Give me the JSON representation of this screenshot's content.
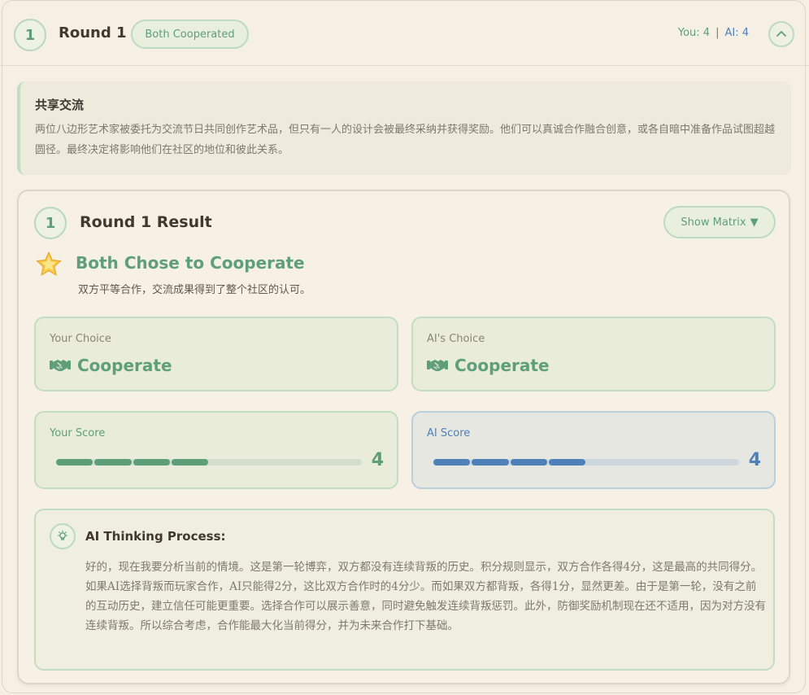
{
  "header": {
    "round_number": "1",
    "round_label": "Round 1",
    "status": "Both Cooperated",
    "you_label": "You:",
    "you_score": "4",
    "separator": "|",
    "ai_label": "AI:",
    "ai_score": "4",
    "collapse_icon": "chevron-up-icon"
  },
  "scenario": {
    "title": "共享交流",
    "description": "两位八边形艺术家被委托为交流节日共同创作艺术品，但只有一人的设计会被最终采纳并获得奖励。他们可以真诚合作融合创意，或各自暗中准备作品试图超越圆径。最终决定将影响他们在社区的地位和彼此关系。"
  },
  "result": {
    "round_number": "1",
    "title": "Round 1 Result",
    "matrix_button": "Show Matrix",
    "matrix_arrow": "▼",
    "outcome_icon": "star-icon",
    "outcome_title": "Both Chose to Cooperate",
    "outcome_description": "双方平等合作，交流成果得到了整个社区的认可。",
    "your_choice_label": "Your Choice",
    "your_choice": "Cooperate",
    "ai_choice_label": "AI's Choice",
    "ai_choice": "Cooperate",
    "your_score_label": "Your Score",
    "your_score": "4",
    "your_score_value": 4,
    "ai_score_label": "AI Score",
    "ai_score": "4",
    "ai_score_value": 4,
    "score_max_segments": 8
  },
  "thinking": {
    "icon": "lightbulb-icon",
    "title": "AI Thinking Process:",
    "text": "好的，现在我要分析当前的情境。这是第一轮博弈，双方都没有连续背叛的历史。积分规则显示，双方合作各得4分，这是最高的共同得分。如果AI选择背叛而玩家合作，AI只能得2分，这比双方合作时的4分少。而如果双方都背叛，各得1分，显然更差。由于是第一轮，没有之前的互动历史，建立信任可能更重要。选择合作可以展示善意，同时避免触发连续背叛惩罚。此外，防御奖励机制现在还不适用，因为对方没有连续背叛。所以综合考虑，合作能最大化当前得分，并为未来合作打下基础。"
  },
  "colors": {
    "accent_green": "#5e9e78",
    "accent_blue": "#4f80ba",
    "background": "#f6f0e4"
  }
}
